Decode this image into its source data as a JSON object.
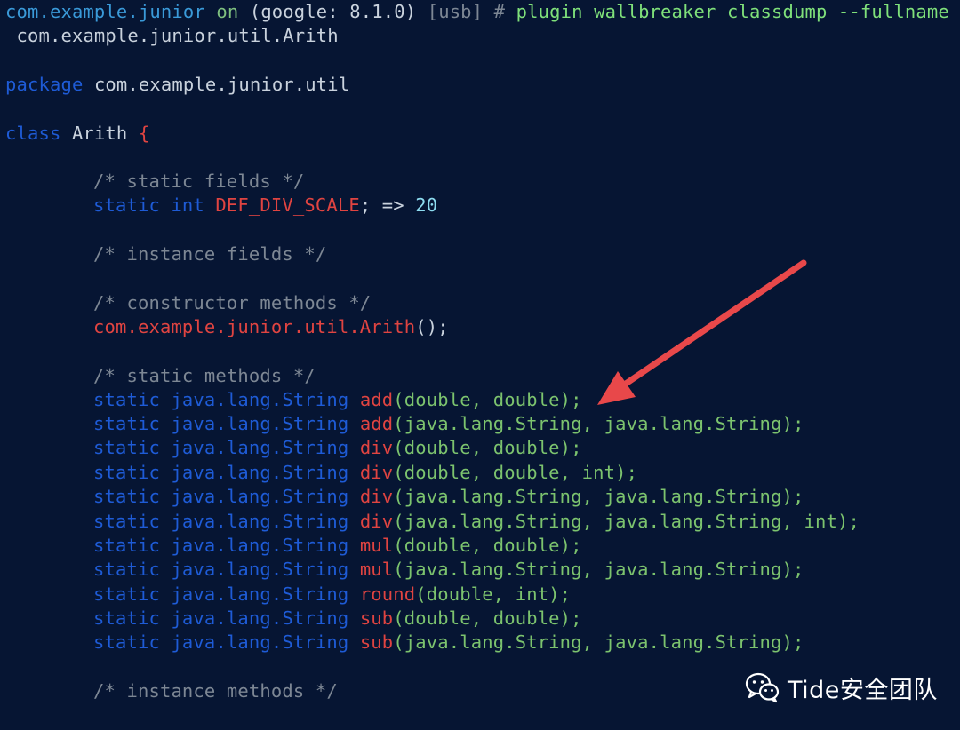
{
  "terminal": {
    "prompt": {
      "app": "com.example.junior",
      "on": " on ",
      "device": "(google: 8.1.0)",
      "usb": " [usb] # ",
      "command": "plugin wallbreaker classdump --fullname"
    },
    "command_arg": " com.example.junior.util.Arith",
    "package_kw": "package",
    "package_name": " com.example.junior.util",
    "class_kw": "class",
    "class_name": " Arith ",
    "class_brace": "{",
    "static_fields_comment": "/* static fields */",
    "static_field": {
      "mods": "static int",
      "name": "DEF_DIV_SCALE",
      "mid": "; => ",
      "value": "20"
    },
    "instance_fields_comment": "/* instance fields */",
    "constructor_comment": "/* constructor methods */",
    "constructor": {
      "name": "com.example.junior.util.Arith",
      "rest": "();"
    },
    "static_methods_comment": "/* static methods */",
    "static_methods": [
      {
        "mods": "static java.lang.String ",
        "name": "add",
        "args": "(double, double);"
      },
      {
        "mods": "static java.lang.String ",
        "name": "add",
        "args": "(java.lang.String, java.lang.String);"
      },
      {
        "mods": "static java.lang.String ",
        "name": "div",
        "args": "(double, double);"
      },
      {
        "mods": "static java.lang.String ",
        "name": "div",
        "args": "(double, double, int);"
      },
      {
        "mods": "static java.lang.String ",
        "name": "div",
        "args": "(java.lang.String, java.lang.String);"
      },
      {
        "mods": "static java.lang.String ",
        "name": "div",
        "args": "(java.lang.String, java.lang.String, int);"
      },
      {
        "mods": "static java.lang.String ",
        "name": "mul",
        "args": "(double, double);"
      },
      {
        "mods": "static java.lang.String ",
        "name": "mul",
        "args": "(java.lang.String, java.lang.String);"
      },
      {
        "mods": "static java.lang.String ",
        "name": "round",
        "args": "(double, int);"
      },
      {
        "mods": "static java.lang.String ",
        "name": "sub",
        "args": "(double, double);"
      },
      {
        "mods": "static java.lang.String ",
        "name": "sub",
        "args": "(java.lang.String, java.lang.String);"
      }
    ],
    "instance_methods_comment": "/* instance methods */"
  },
  "annotation": {
    "icon": "red-arrow-icon",
    "color": "#e8484a"
  },
  "watermark": {
    "icon": "wechat-icon",
    "text": "Tide安全团队"
  },
  "colors": {
    "background": "#061533",
    "keyword": "#1e5bd6",
    "identifier": "#e04441",
    "argument": "#7cc36e",
    "comment": "#7d8794",
    "value": "#8ddcf0"
  }
}
